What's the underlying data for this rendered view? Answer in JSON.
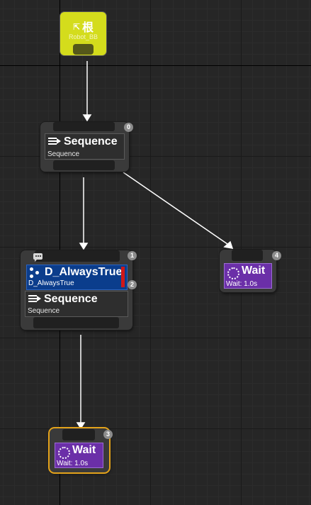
{
  "root": {
    "title": "根",
    "blackboard": "Robot_BB"
  },
  "nodes": {
    "sequence_top": {
      "name": "Sequence",
      "subtitle": "Sequence",
      "index": "0"
    },
    "decorator": {
      "name": "D_AlwaysTrue",
      "subtitle": "D_AlwaysTrue",
      "index": "2"
    },
    "sequence_mid": {
      "name": "Sequence",
      "subtitle": "Sequence",
      "index": "1"
    },
    "wait_right": {
      "name": "Wait",
      "subtitle": "Wait: 1.0s",
      "index": "4"
    },
    "wait_bottom": {
      "name": "Wait",
      "subtitle": "Wait: 1.0s",
      "index": "3"
    }
  },
  "colors": {
    "root": "#d4dc1c",
    "composite": "#3a3a3a",
    "task": "#6b2fa8",
    "decorator": "#0b3d8c",
    "selection": "#e3a21a",
    "wire": "#ffffff"
  },
  "icons": {
    "root": "root-icon",
    "sequence": "sequence-icon",
    "decorator": "decorator-icon",
    "wait": "wait-icon",
    "comment": "comment-icon"
  }
}
